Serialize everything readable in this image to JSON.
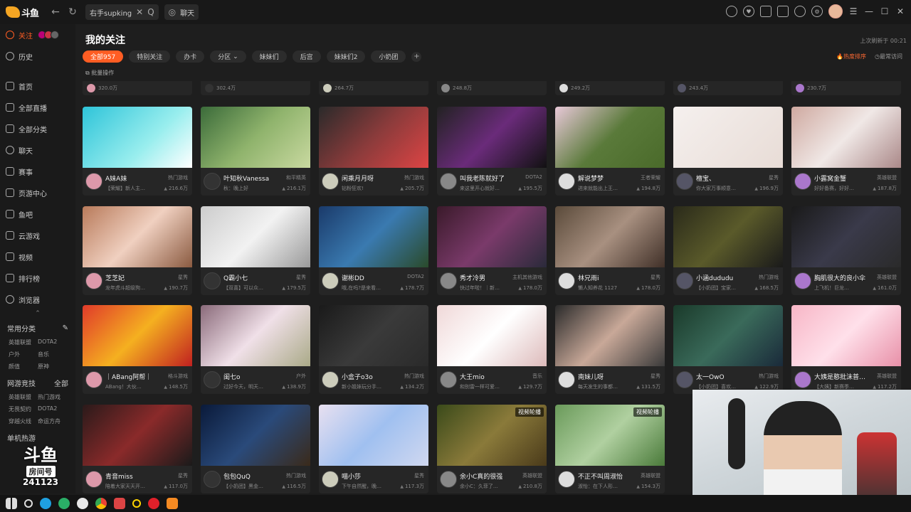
{
  "app": {
    "logo_text": "斗鱼"
  },
  "tabs": [
    {
      "label": "右手supking"
    },
    {
      "label": "聊天"
    }
  ],
  "nav": {
    "back": "←",
    "refresh": "↻",
    "close": "✕",
    "search": "Q"
  },
  "sidebar": {
    "follow_label": "关注",
    "items": [
      "历史",
      "首页",
      "全部直播",
      "全部分类",
      "聊天",
      "赛事",
      "页游中心",
      "鱼吧",
      "云游戏",
      "视频",
      "排行榜",
      "浏览器"
    ],
    "common_title": "常用分类",
    "common": [
      "英雄联盟",
      "DOTA2",
      "户外",
      "音乐",
      "颜值",
      "原神"
    ],
    "esports_title": "网游竞技",
    "esports_all": "全部",
    "esports": [
      "英雄联盟",
      "热门游戏",
      "无畏契约",
      "DOTA2",
      "穿越火线",
      "命运方舟"
    ],
    "single_title": "单机热游"
  },
  "main": {
    "title": "我的关注",
    "last_refresh": "上次刷新于 00:21",
    "filters": [
      "全部957",
      "特别关注",
      "办卡",
      "分区",
      "妹妹们",
      "后宫",
      "妹妹们2",
      "小奶团"
    ],
    "sort_hot": "热度排序",
    "sort_recent": "最常访问",
    "batch": "批量操作"
  },
  "strip": [
    {
      "sub": "S14第一个王者…",
      "views": "320.0万"
    },
    {
      "sub": "【✗·✗】黑白…",
      "views": "302.4万"
    },
    {
      "sub": "包包代播~~",
      "views": "264.7万"
    },
    {
      "sub": "我去老家演唱…",
      "views": "248.8万"
    },
    {
      "sub": "今天我要王者不…",
      "views": "249.2万"
    },
    {
      "sub": "【小奶团】反转…",
      "views": "243.4万"
    },
    {
      "sub": "新年新番新领域…",
      "views": "230.7万"
    }
  ],
  "rooms": [
    {
      "name": "A妹A妹",
      "cat": "热门游戏",
      "sub": "【荣耀】新人主…",
      "views": "216.6万"
    },
    {
      "name": "叶知秋Vanessa",
      "cat": "和平精英",
      "sub": "秋：晚上好",
      "views": "216.1万"
    },
    {
      "name": "闲乘月月呀",
      "cat": "热门游戏",
      "sub": "钻粉狂欢!",
      "views": "205.7万"
    },
    {
      "name": "叫我老陈就好了",
      "cat": "DOTA2",
      "sub": "来这里开心就好…",
      "views": "195.5万"
    },
    {
      "name": "解说梦梦",
      "cat": "王者荣耀",
      "sub": "进来就能出上王…",
      "views": "194.8万"
    },
    {
      "name": "檀宝、",
      "cat": "星秀",
      "sub": "你大家万事顺意…",
      "views": "196.9万"
    },
    {
      "name": "小露窝金蟹",
      "cat": "英雄联盟",
      "sub": "好好备赛，好好…",
      "views": "187.8万"
    },
    {
      "name": "芝芝妃",
      "cat": "星秀",
      "sub": "龙年虎斗超级狗…",
      "views": "190.7万"
    },
    {
      "name": "Q霸小七",
      "cat": "星秀",
      "sub": "【双喜】可以众…",
      "views": "179.5万"
    },
    {
      "name": "谢彬DD",
      "cat": "DOTA2",
      "sub": "哦,在吗?是来看…",
      "views": "178.7万"
    },
    {
      "name": "秀才冷男",
      "cat": "主机其他游戏",
      "sub": "快过年啦！｜新…",
      "views": "178.0万"
    },
    {
      "name": "林兄雨i",
      "cat": "星秀",
      "sub": "懒人知养花 1127",
      "views": "178.0万"
    },
    {
      "name": "小涵dududu",
      "cat": "热门游戏",
      "sub": "【小奶团】宝家…",
      "views": "168.5万"
    },
    {
      "name": "胸肌很大的良小伞",
      "cat": "英雄联盟",
      "sub": "上飞机！巨龙…",
      "views": "161.0万"
    },
    {
      "name": "｜ABang阿帮｜",
      "cat": "格斗游戏",
      "sub": "ABang！大伙…",
      "views": "148.5万"
    },
    {
      "name": "闺七o",
      "cat": "户外",
      "sub": "过好今天，明天…",
      "views": "138.9万"
    },
    {
      "name": "小盒子o3o",
      "cat": "热门游戏",
      "sub": "新小姐妹玩分手…",
      "views": "134.2万"
    },
    {
      "name": "大王mio",
      "cat": "音乐",
      "sub": "和别雷一样可爱…",
      "views": "129.7万"
    },
    {
      "name": "南妹儿呀",
      "cat": "星秀",
      "sub": "每天发生的事都…",
      "views": "131.5万"
    },
    {
      "name": "太一OwO",
      "cat": "热门游戏",
      "sub": "【小奶团】喜欢…",
      "views": "122.9万"
    },
    {
      "name": "大姨是憨批沫普…",
      "cat": "英雄联盟",
      "sub": "【大姨】新赛季…",
      "views": "117.2万"
    },
    {
      "name": "青音miss",
      "cat": "星秀",
      "sub": "陪着大家天天开…",
      "views": "117.0万"
    },
    {
      "name": "包包QuQ",
      "cat": "热门游戏",
      "sub": "【小奶团】黑金…",
      "views": "116.5万"
    },
    {
      "name": "喵小莎",
      "cat": "星秀",
      "sub": "下午自然醒，晚…",
      "views": "117.3万"
    },
    {
      "name": "余小C真的很强",
      "cat": "英雄联盟",
      "sub": "余小C：久菲了…",
      "views": "210.8万",
      "tag": "视频轮播"
    },
    {
      "name": "不正不叫周淑怡",
      "cat": "英雄联盟",
      "sub": "淑怡：在下人形…",
      "views": "154.3万",
      "tag": "视频轮播"
    }
  ],
  "overlay": {
    "brand": "斗鱼",
    "room_label": "房间号",
    "room_id": "241123"
  },
  "colors": {
    "accent": "#ff5d23",
    "bg": "#1e1e1e",
    "card": "#262626"
  }
}
